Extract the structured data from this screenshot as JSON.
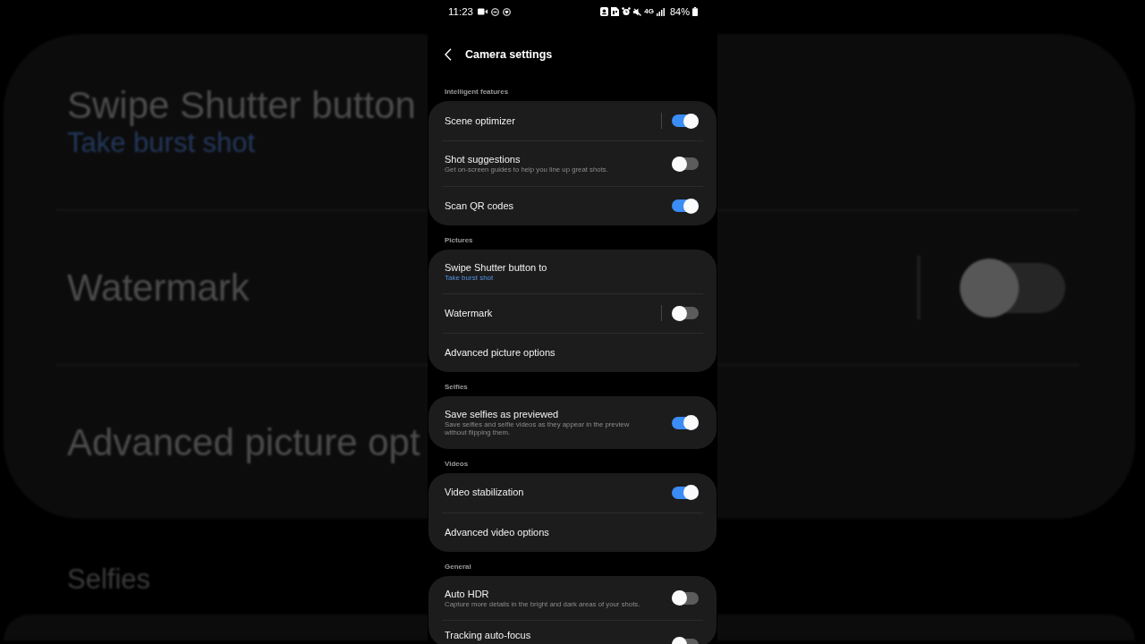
{
  "background_zoom": {
    "rows": [
      {
        "kind": "link",
        "title": "Swipe Shutter button",
        "value": "Take burst shot"
      },
      {
        "kind": "switch",
        "title": "Watermark",
        "on": false,
        "separator": true
      },
      {
        "kind": "link",
        "title": "Advanced picture opt"
      }
    ],
    "next_header": "Selfies"
  },
  "status_bar": {
    "time": "11:23",
    "network": "4G",
    "battery": "84%"
  },
  "app_bar": {
    "title": "Camera settings"
  },
  "sections": [
    {
      "header": "Intelligent features",
      "rows": [
        {
          "kind": "switch",
          "title": "Scene optimizer",
          "on": true,
          "separator": true
        },
        {
          "kind": "switch",
          "title": "Shot suggestions",
          "description": "Get on-screen guides to help you line up great shots.",
          "on": false,
          "separator": false
        },
        {
          "kind": "switch",
          "title": "Scan QR codes",
          "on": true,
          "separator": false
        }
      ]
    },
    {
      "header": "Pictures",
      "rows": [
        {
          "kind": "link",
          "title": "Swipe Shutter button to",
          "value": "Take burst shot"
        },
        {
          "kind": "switch",
          "title": "Watermark",
          "on": false,
          "separator": true
        },
        {
          "kind": "link",
          "title": "Advanced picture options"
        }
      ]
    },
    {
      "header": "Selfies",
      "rows": [
        {
          "kind": "switch",
          "title": "Save selfies as previewed",
          "description": "Save selfies and selfie videos as they appear in the preview without flipping them.",
          "on": true,
          "separator": false
        }
      ]
    },
    {
      "header": "Videos",
      "rows": [
        {
          "kind": "switch",
          "title": "Video stabilization",
          "on": true,
          "separator": false
        },
        {
          "kind": "link",
          "title": "Advanced video options"
        }
      ]
    },
    {
      "header": "General",
      "rows": [
        {
          "kind": "switch",
          "title": "Auto HDR",
          "description": "Capture more details in the bright and dark areas of your shots.",
          "on": false,
          "separator": false
        },
        {
          "kind": "switch",
          "title": "Tracking auto-focus",
          "on": false,
          "separator": false
        }
      ]
    }
  ]
}
